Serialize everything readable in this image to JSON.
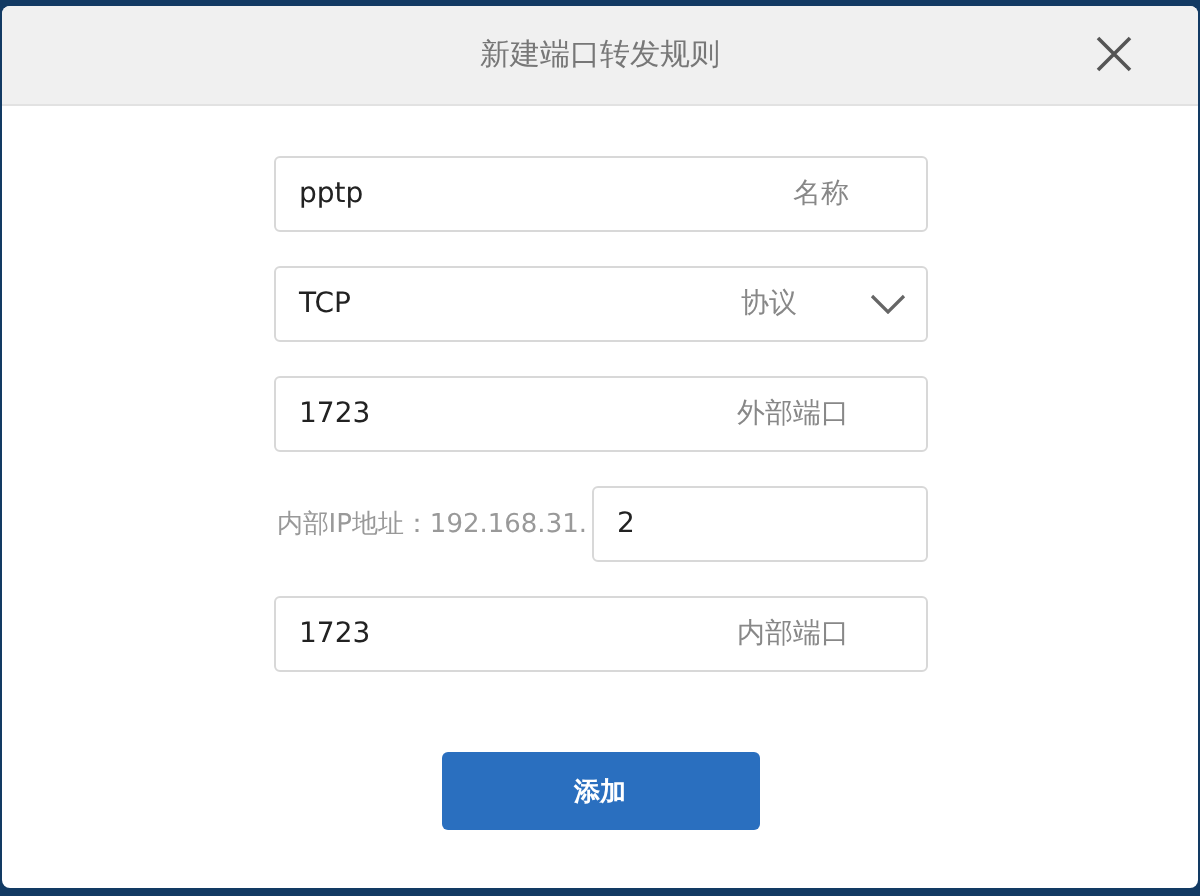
{
  "dialog": {
    "title": "新建端口转发规则"
  },
  "fields": [
    {
      "kind": "text",
      "value": "pptp",
      "label": "名称"
    },
    {
      "kind": "select",
      "value": "TCP",
      "label": "协议"
    },
    {
      "kind": "text",
      "value": "1723",
      "label": "外部端口"
    },
    {
      "kind": "ip",
      "label": "内部IP地址：192.168.31.",
      "value": "2"
    },
    {
      "kind": "text",
      "value": "1723",
      "label": "内部端口"
    }
  ],
  "buttons": [
    "添加"
  ]
}
